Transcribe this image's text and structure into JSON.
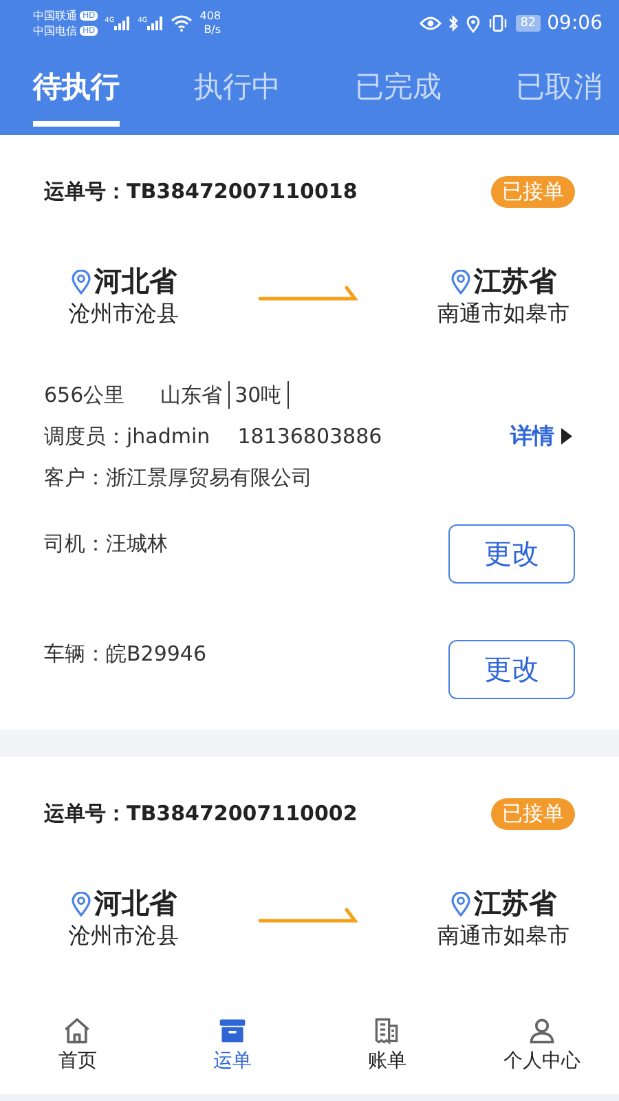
{
  "status_bar": {
    "carriers": [
      {
        "name": "中国联通",
        "badge": "HD"
      },
      {
        "name": "中国电信",
        "badge": "HD"
      }
    ],
    "signals": [
      "4G",
      "4G"
    ],
    "speed": "408",
    "speed_unit": "B/s",
    "battery": "82",
    "time": "09:06"
  },
  "tabs": [
    {
      "label": "待执行",
      "selected": true
    },
    {
      "label": "执行中",
      "selected": false
    },
    {
      "label": "已完成",
      "selected": false
    },
    {
      "label": "已取消",
      "selected": false
    }
  ],
  "orders": [
    {
      "number_label": "运单号：",
      "number": "TB38472007110018",
      "status": "已接单",
      "from": {
        "province": "河北省",
        "city": "沧州市沧县"
      },
      "to": {
        "province": "江苏省",
        "city": "南通市如皋市"
      },
      "distance": "656公里",
      "region": "山东省",
      "weight": "30吨",
      "dispatcher": "调度员：jhadmin",
      "phone": "18136803886",
      "details_link": "详情",
      "customer": "客户：浙江景厚贸易有限公司",
      "assignments": [
        {
          "label": "司机：汪城林",
          "button": "更改"
        },
        {
          "label": "车辆：皖B29946",
          "button": "更改"
        }
      ]
    },
    {
      "number_label": "运单号：",
      "number": "TB38472007110002",
      "status": "已接单",
      "from": {
        "province": "河北省",
        "city": "沧州市沧县"
      },
      "to": {
        "province": "江苏省",
        "city": "南通市如皋市"
      }
    }
  ],
  "bottom_nav": [
    {
      "label": "首页",
      "selected": false
    },
    {
      "label": "运单",
      "selected": true
    },
    {
      "label": "账单",
      "selected": false
    },
    {
      "label": "个人中心",
      "selected": false
    }
  ]
}
